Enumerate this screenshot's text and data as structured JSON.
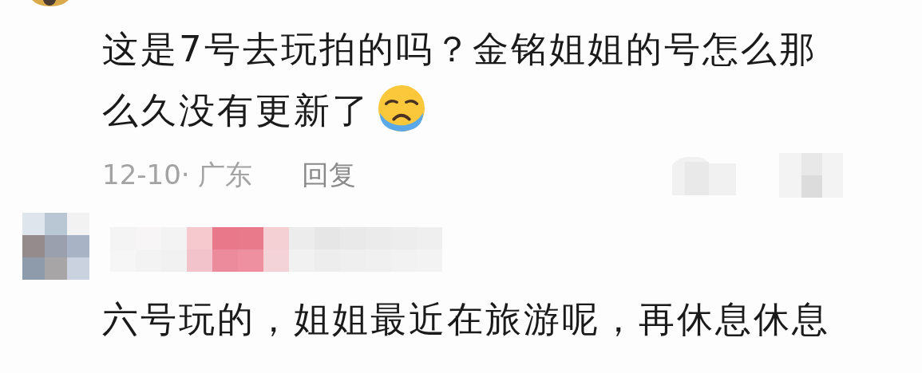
{
  "comment": {
    "lines": [
      "这是7号去玩拍的吗？金铭姐姐的号怎么那",
      "么久没有更新了"
    ],
    "meta": "12-10· 广东",
    "reply": "回复"
  },
  "reply_comment": {
    "text": "六号玩的，姐姐最近在旅游呢，再休息休息"
  }
}
